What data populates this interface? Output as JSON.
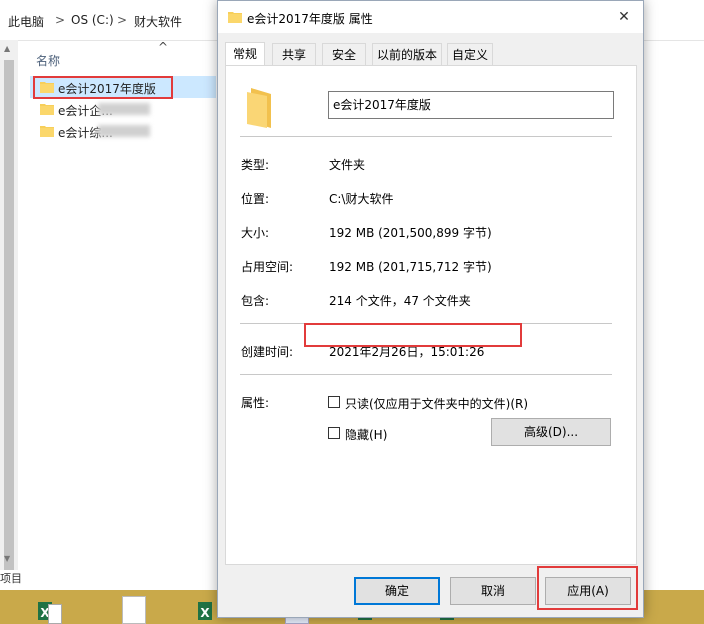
{
  "explorer": {
    "breadcrumb": [
      "此电脑",
      "OS (C:)",
      "财大软件"
    ],
    "separator": ">",
    "column_name": "名称",
    "sort_arrow": "^",
    "files": [
      {
        "name": "e会计2017年度版",
        "selected": true
      },
      {
        "name": "e会计企...",
        "selected": false
      },
      {
        "name": "e会计综...",
        "selected": false
      }
    ],
    "bottom_label": "项目"
  },
  "dialog": {
    "title": "e会计2017年度版 属性",
    "close_glyph": "✕",
    "tabs": [
      "常规",
      "共享",
      "安全",
      "以前的版本",
      "自定义"
    ],
    "folder_name": "e会计2017年度版",
    "rows": [
      {
        "label": "类型:",
        "value": "文件夹"
      },
      {
        "label": "位置:",
        "value": "C:\\财大软件"
      },
      {
        "label": "大小:",
        "value": "192 MB (201,500,899 字节)"
      },
      {
        "label": "占用空间:",
        "value": "192 MB (201,715,712 字节)"
      },
      {
        "label": "包含:",
        "value": "214 个文件，47 个文件夹"
      }
    ],
    "created": {
      "label": "创建时间:",
      "value": "2021年2月26日，15:01:26"
    },
    "attributes": {
      "label": "属性:",
      "readonly": "只读(仅应用于文件夹中的文件)(R)",
      "hidden": "隐藏(H)",
      "advanced": "高级(D)..."
    },
    "buttons": {
      "ok": "确定",
      "cancel": "取消",
      "apply": "应用(A)"
    }
  },
  "colors": {
    "highlight": "#e23b3b",
    "folder": "#f7cf5a",
    "selection": "#cce8ff",
    "accent": "#0078d7"
  },
  "icons": {
    "folder": "folder-icon",
    "close": "close-icon",
    "excel": "excel-icon"
  }
}
